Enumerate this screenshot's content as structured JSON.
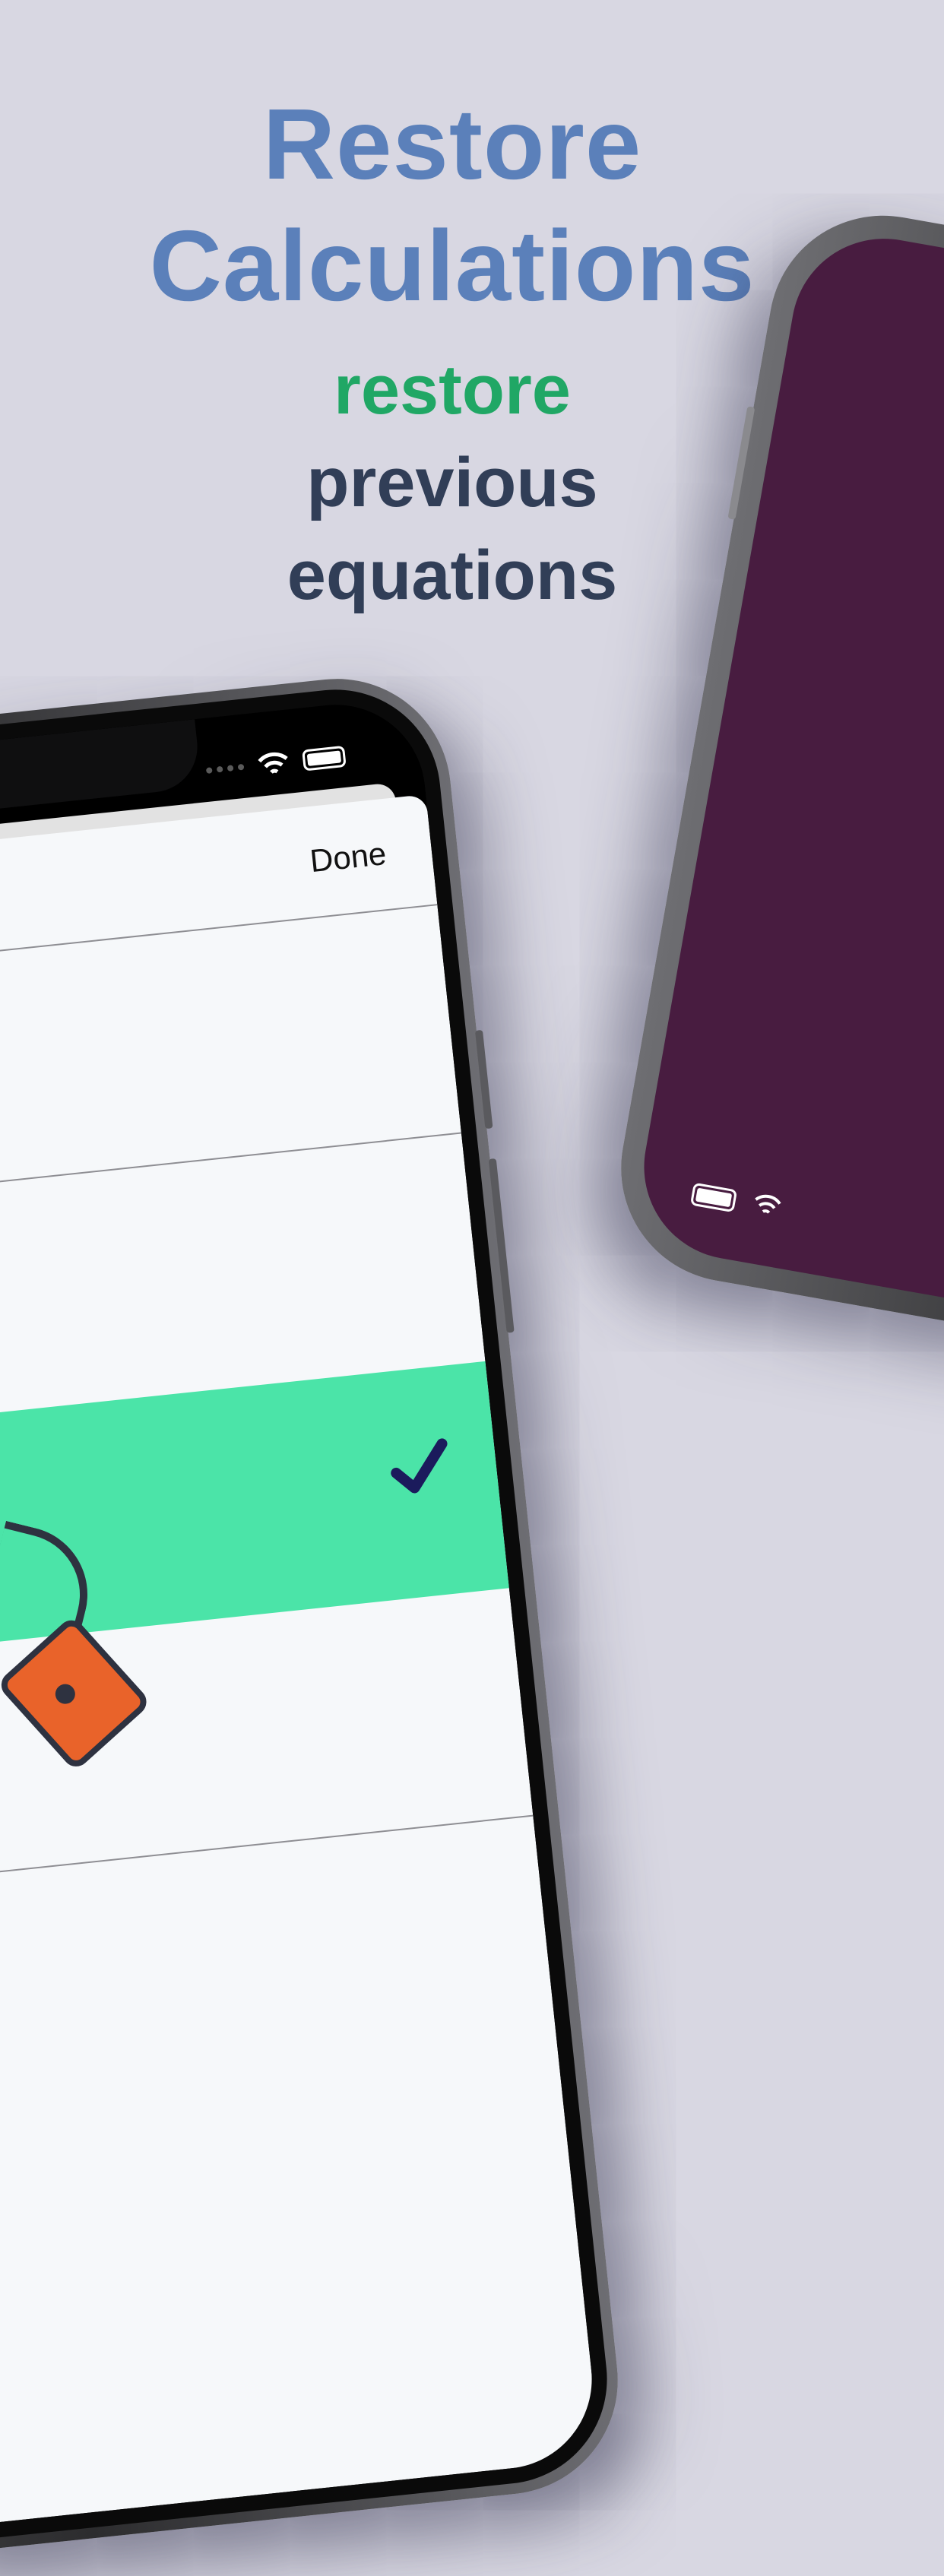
{
  "headline": {
    "title_line1": "Restore",
    "title_line2": "Calculations",
    "subtitle_highlight": "restore",
    "subtitle_line2": "previous",
    "subtitle_line3": "equations"
  },
  "colors": {
    "background": "#d8d7e2",
    "title": "#5b80ba",
    "highlight": "#20a765",
    "subtitle": "#313e57",
    "selected_row": "#4be4a8",
    "check": "#1b1b5c",
    "second_phone_screen": "#481c40"
  },
  "main_phone": {
    "status_icons": [
      "signal-dots-icon",
      "wifi-icon",
      "battery-icon"
    ],
    "sheet": {
      "done_label": "Done",
      "rows": [
        {
          "selected": false
        },
        {
          "selected": false
        },
        {
          "selected": true,
          "trailing_icon": "checkmark-icon"
        },
        {
          "selected": false
        }
      ]
    }
  },
  "second_phone": {
    "status_icons": [
      "battery-icon",
      "wifi-icon"
    ]
  }
}
